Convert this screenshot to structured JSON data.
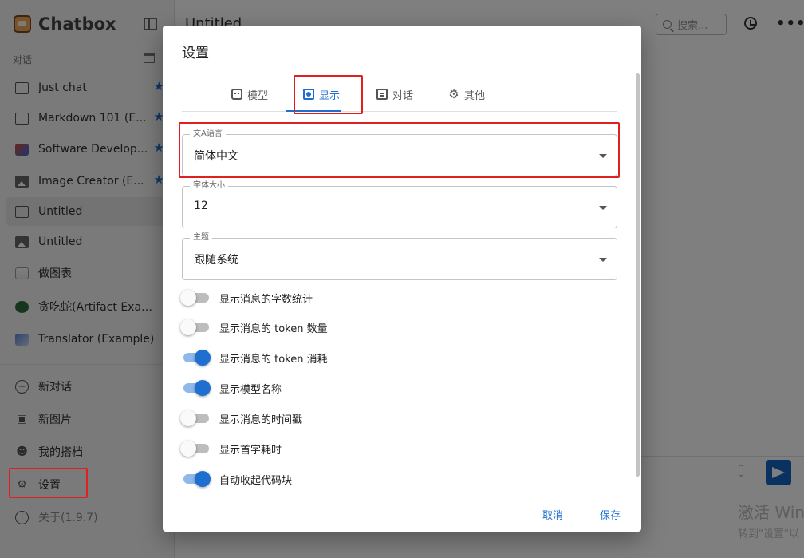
{
  "sidebar": {
    "brand": "Chatbox",
    "section_label": "对话",
    "conversations": [
      {
        "label": "Just chat",
        "icon": "chat-bubble-icon",
        "starred": true
      },
      {
        "label": "Markdown 101 (E...",
        "icon": "chat-bubble-icon",
        "starred": true
      },
      {
        "label": "Software Develop...",
        "icon": "avatar-icon",
        "starred": true
      },
      {
        "label": "Image Creator (E...",
        "icon": "image-icon",
        "starred": true
      },
      {
        "label": "Untitled",
        "icon": "chat-bubble-icon",
        "starred": false,
        "selected": true
      },
      {
        "label": "Untitled",
        "icon": "image-icon",
        "starred": false
      },
      {
        "label": "做图表",
        "icon": "chart-avatar-icon",
        "starred": false
      },
      {
        "label": "贪吃蛇(Artifact Example)",
        "icon": "snake-avatar-icon",
        "starred": false
      },
      {
        "label": "Translator (Example)",
        "icon": "translate-avatar-icon",
        "starred": false
      }
    ],
    "menu": {
      "new_chat": "新对话",
      "new_image": "新图片",
      "my_partners": "我的搭档",
      "settings": "设置",
      "about": "关于(1.9.7)"
    }
  },
  "main": {
    "title": "Untitled",
    "search_placeholder": "搜索...",
    "watermark_line1": "激活 Win",
    "watermark_line2": "转到\"设置\"以"
  },
  "dialog": {
    "title": "设置",
    "tabs": [
      {
        "label": "模型",
        "icon": "robot-icon",
        "active": false
      },
      {
        "label": "显示",
        "icon": "display-icon",
        "active": true
      },
      {
        "label": "对话",
        "icon": "message-icon",
        "active": false
      },
      {
        "label": "其他",
        "icon": "gear-icon",
        "active": false
      }
    ],
    "fields": {
      "language": {
        "label": "语言",
        "value": "简体中文"
      },
      "font_size": {
        "label": "字体大小",
        "value": "12"
      },
      "theme": {
        "label": "主题",
        "value": "跟随系统"
      }
    },
    "toggles": [
      {
        "label": "显示消息的字数统计",
        "on": false
      },
      {
        "label": "显示消息的 token 数量",
        "on": false
      },
      {
        "label": "显示消息的 token 消耗",
        "on": true
      },
      {
        "label": "显示模型名称",
        "on": true
      },
      {
        "label": "显示消息的时间戳",
        "on": false
      },
      {
        "label": "显示首字耗时",
        "on": false
      },
      {
        "label": "自动收起代码块",
        "on": true
      }
    ],
    "cancel": "取消",
    "save": "保存"
  },
  "colors": {
    "accent": "#1e6fd0",
    "annotation_red": "#e02020"
  }
}
